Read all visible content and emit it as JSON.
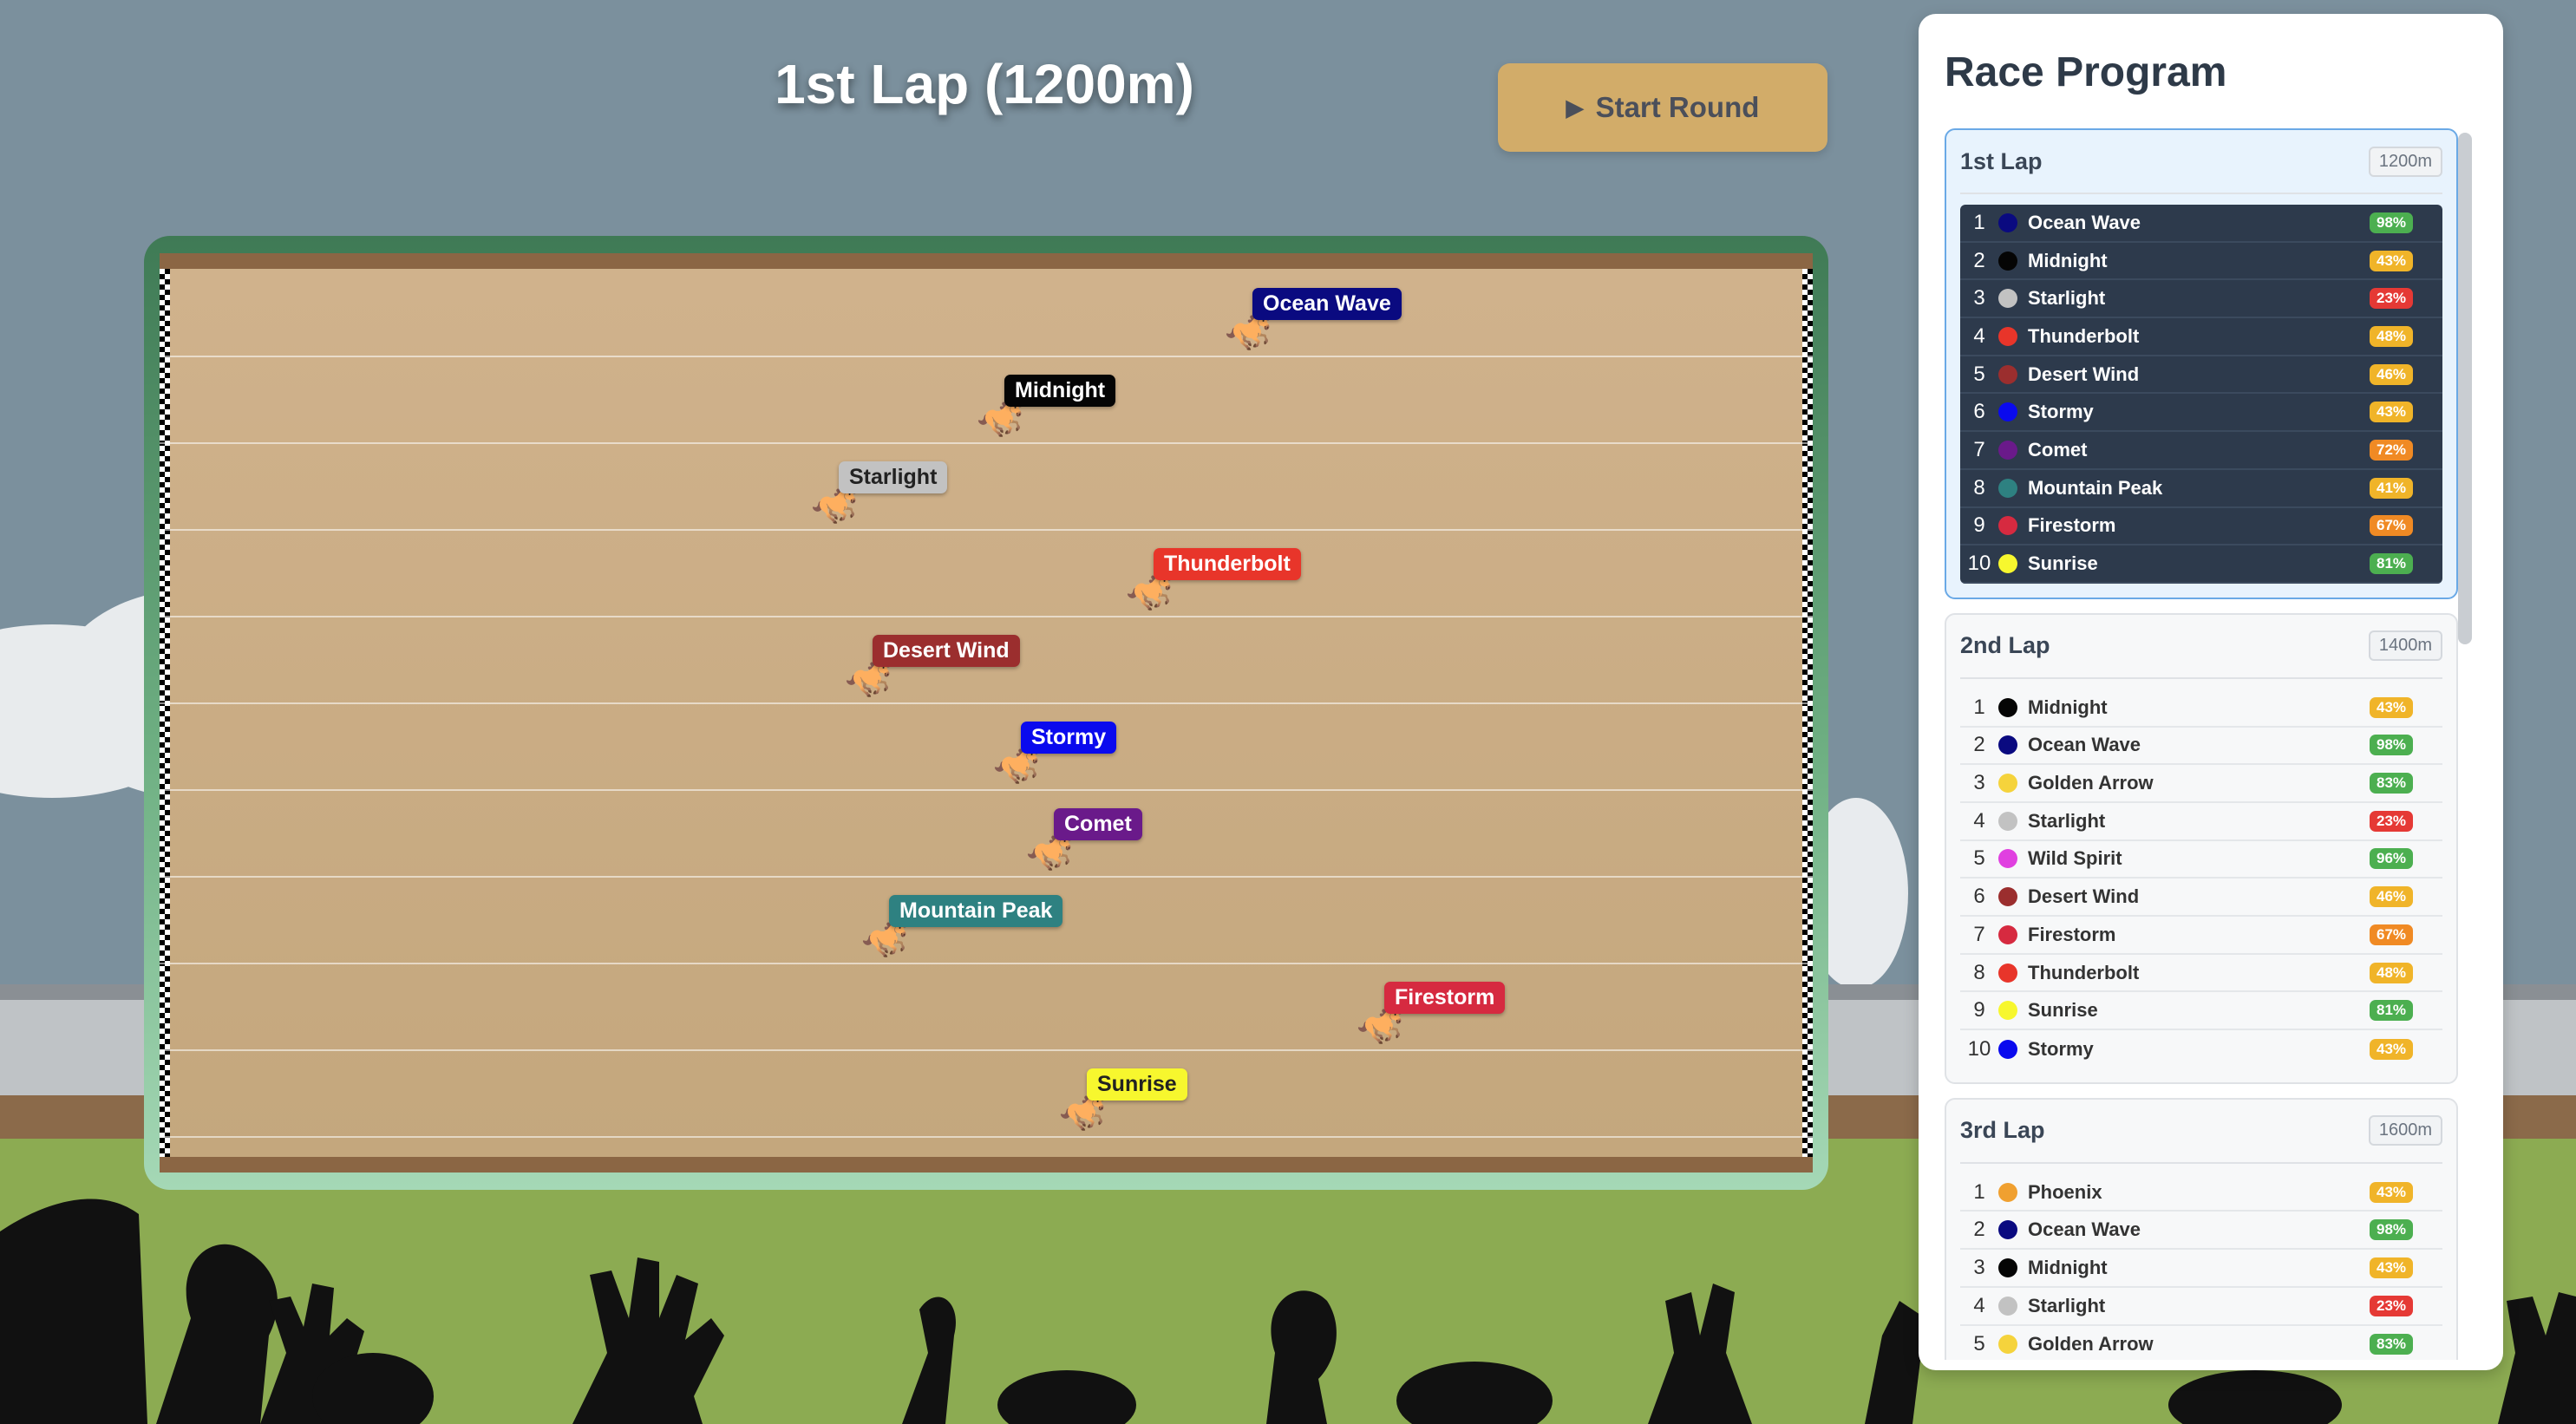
{
  "race": {
    "title": "1st Lap (1200m)",
    "start_button_label": "Start Round",
    "start_button_icon": "play-icon"
  },
  "colors": {
    "sky": "#7b909d",
    "grass": "#8cab52",
    "button": "#d2ac69",
    "track": "#c8aa82",
    "panel": "#ffffff"
  },
  "track": {
    "runners": [
      {
        "name": "Ocean Wave",
        "color": "#0a0a80",
        "text": "#ffffff",
        "progress": 0.66
      },
      {
        "name": "Midnight",
        "color": "#050505",
        "text": "#ffffff",
        "progress": 0.51
      },
      {
        "name": "Starlight",
        "color": "#c2c2c2",
        "text": "#222222",
        "progress": 0.41
      },
      {
        "name": "Thunderbolt",
        "color": "#e8352a",
        "text": "#ffffff",
        "progress": 0.6
      },
      {
        "name": "Desert Wind",
        "color": "#9b2e2e",
        "text": "#ffffff",
        "progress": 0.43
      },
      {
        "name": "Stormy",
        "color": "#0a0aee",
        "text": "#ffffff",
        "progress": 0.52
      },
      {
        "name": "Comet",
        "color": "#6a1a8a",
        "text": "#ffffff",
        "progress": 0.54
      },
      {
        "name": "Mountain Peak",
        "color": "#2e8181",
        "text": "#ffffff",
        "progress": 0.44
      },
      {
        "name": "Firestorm",
        "color": "#d62a40",
        "text": "#ffffff",
        "progress": 0.74
      },
      {
        "name": "Sunrise",
        "color": "#f7f72e",
        "text": "#222222",
        "progress": 0.56
      }
    ]
  },
  "program": {
    "title": "Race Program",
    "laps": [
      {
        "name": "1st Lap",
        "distance": "1200m",
        "active": true,
        "entries": [
          {
            "pos": "1",
            "name": "Ocean Wave",
            "color": "#0a0a80",
            "pct": "98%",
            "pct_color": "#4caf50"
          },
          {
            "pos": "2",
            "name": "Midnight",
            "color": "#050505",
            "pct": "43%",
            "pct_color": "#f0b429"
          },
          {
            "pos": "3",
            "name": "Starlight",
            "color": "#c2c2c2",
            "pct": "23%",
            "pct_color": "#e53935"
          },
          {
            "pos": "4",
            "name": "Thunderbolt",
            "color": "#e8352a",
            "pct": "48%",
            "pct_color": "#f0b429"
          },
          {
            "pos": "5",
            "name": "Desert Wind",
            "color": "#9b2e2e",
            "pct": "46%",
            "pct_color": "#f0b429"
          },
          {
            "pos": "6",
            "name": "Stormy",
            "color": "#0a0aee",
            "pct": "43%",
            "pct_color": "#f0b429"
          },
          {
            "pos": "7",
            "name": "Comet",
            "color": "#6a1a8a",
            "pct": "72%",
            "pct_color": "#f08a24"
          },
          {
            "pos": "8",
            "name": "Mountain Peak",
            "color": "#2e8181",
            "pct": "41%",
            "pct_color": "#f0b429"
          },
          {
            "pos": "9",
            "name": "Firestorm",
            "color": "#d62a40",
            "pct": "67%",
            "pct_color": "#f08a24"
          },
          {
            "pos": "10",
            "name": "Sunrise",
            "color": "#f7f72e",
            "pct": "81%",
            "pct_color": "#4caf50"
          }
        ]
      },
      {
        "name": "2nd Lap",
        "distance": "1400m",
        "active": false,
        "entries": [
          {
            "pos": "1",
            "name": "Midnight",
            "color": "#050505",
            "pct": "43%",
            "pct_color": "#f0b429"
          },
          {
            "pos": "2",
            "name": "Ocean Wave",
            "color": "#0a0a80",
            "pct": "98%",
            "pct_color": "#4caf50"
          },
          {
            "pos": "3",
            "name": "Golden Arrow",
            "color": "#f5d33c",
            "pct": "83%",
            "pct_color": "#4caf50"
          },
          {
            "pos": "4",
            "name": "Starlight",
            "color": "#c2c2c2",
            "pct": "23%",
            "pct_color": "#e53935"
          },
          {
            "pos": "5",
            "name": "Wild Spirit",
            "color": "#e040e0",
            "pct": "96%",
            "pct_color": "#4caf50"
          },
          {
            "pos": "6",
            "name": "Desert Wind",
            "color": "#9b2e2e",
            "pct": "46%",
            "pct_color": "#f0b429"
          },
          {
            "pos": "7",
            "name": "Firestorm",
            "color": "#d62a40",
            "pct": "67%",
            "pct_color": "#f08a24"
          },
          {
            "pos": "8",
            "name": "Thunderbolt",
            "color": "#e8352a",
            "pct": "48%",
            "pct_color": "#f0b429"
          },
          {
            "pos": "9",
            "name": "Sunrise",
            "color": "#f7f72e",
            "pct": "81%",
            "pct_color": "#4caf50"
          },
          {
            "pos": "10",
            "name": "Stormy",
            "color": "#0a0aee",
            "pct": "43%",
            "pct_color": "#f0b429"
          }
        ]
      },
      {
        "name": "3rd Lap",
        "distance": "1600m",
        "active": false,
        "entries": [
          {
            "pos": "1",
            "name": "Phoenix",
            "color": "#f0a030",
            "pct": "43%",
            "pct_color": "#f0b429"
          },
          {
            "pos": "2",
            "name": "Ocean Wave",
            "color": "#0a0a80",
            "pct": "98%",
            "pct_color": "#4caf50"
          },
          {
            "pos": "3",
            "name": "Midnight",
            "color": "#050505",
            "pct": "43%",
            "pct_color": "#f0b429"
          },
          {
            "pos": "4",
            "name": "Starlight",
            "color": "#c2c2c2",
            "pct": "23%",
            "pct_color": "#e53935"
          },
          {
            "pos": "5",
            "name": "Golden Arrow",
            "color": "#f5d33c",
            "pct": "83%",
            "pct_color": "#4caf50"
          }
        ]
      }
    ]
  }
}
